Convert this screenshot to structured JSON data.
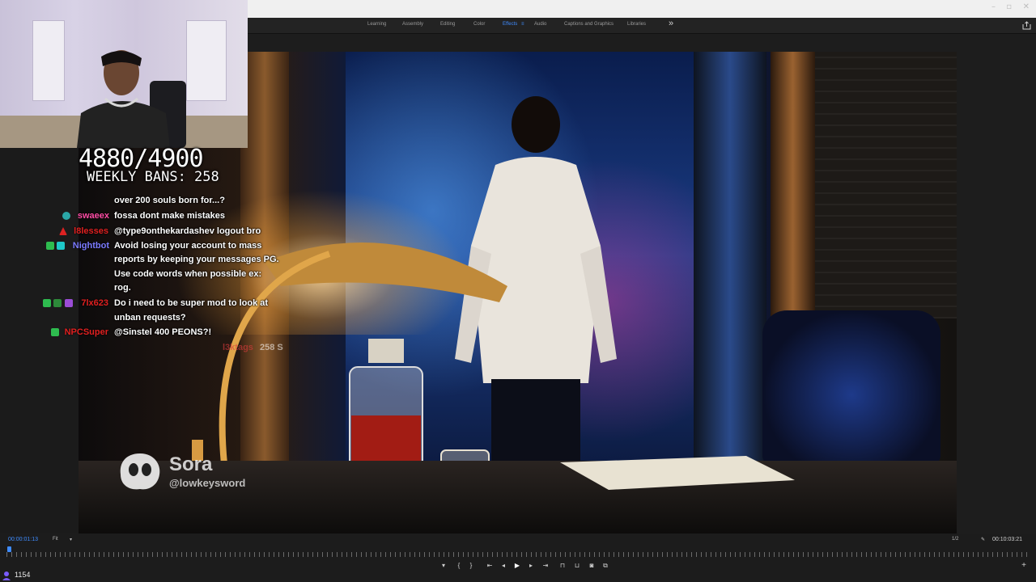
{
  "workspace_tabs": [
    {
      "label": "Learning",
      "active": false
    },
    {
      "label": "Assembly",
      "active": false
    },
    {
      "label": "Editing",
      "active": false
    },
    {
      "label": "Color",
      "active": false
    },
    {
      "label": "Effects",
      "active": true
    },
    {
      "label": "Audio",
      "active": false
    },
    {
      "label": "Captions and Graphics",
      "active": false
    },
    {
      "label": "Libraries",
      "active": false
    }
  ],
  "workspace_more": "»",
  "window_controls": {
    "minimize": "–",
    "maximize": "▫",
    "close": "✕"
  },
  "overlay": {
    "counter": "4880/4900",
    "weekly_bans": "WEEKLY BANS: 258"
  },
  "chat": [
    {
      "user": "",
      "user_color": "#2f3bd8",
      "text": "over 200 souls born for...?"
    },
    {
      "user": "swaeex",
      "user_color": "#ff4da6",
      "text": "fossa dont make mistakes"
    },
    {
      "user": "l8lesses",
      "user_color": "#e02020",
      "text": "@type9onthekardashev logout bro"
    },
    {
      "user": "Nightbot",
      "user_color": "#7b7bff",
      "text": "Avoid losing your account to mass"
    },
    {
      "user": "",
      "user_color": "",
      "text": "reports by keeping your messages PG."
    },
    {
      "user": "",
      "user_color": "",
      "text": "Use code words when possible ex:"
    },
    {
      "user": "",
      "user_color": "",
      "text": "rog."
    },
    {
      "user": "7lx623",
      "user_color": "#e02020",
      "text": "Do i need to be super mod to look at"
    },
    {
      "user": "",
      "user_color": "",
      "text": "unban requests?"
    },
    {
      "user": "NPCSuper",
      "user_color": "#e02020",
      "text": "@Sinstel 400 PEONS?!"
    }
  ],
  "faded_message": {
    "user": "l3ktags",
    "amount": "258 S"
  },
  "watermark": {
    "name": "Sora",
    "handle": "@lowkeysword"
  },
  "timecode": {
    "current": "00:00:01:13",
    "duration": "00:10:03:21",
    "fit": "Fit",
    "resolution": "1/2"
  },
  "playback_progress": 0.002,
  "transport_buttons": [
    "mark-in",
    "mark-out-left",
    "mark-out-right",
    "step-back",
    "prev-frame",
    "play",
    "next-frame",
    "step-forward",
    "lift",
    "extract",
    "export-frame",
    "comparison"
  ],
  "viewers": "1154",
  "colors": {
    "accent": "#3f8cff",
    "panel": "#1c1c1c"
  }
}
